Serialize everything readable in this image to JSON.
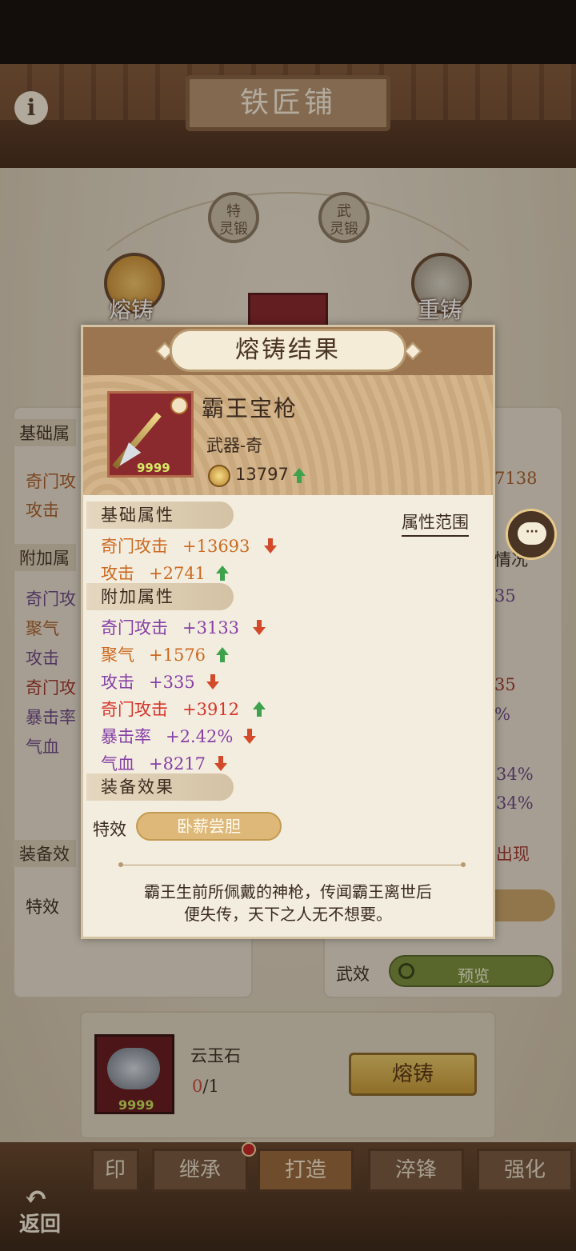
{
  "app": {
    "title": "铁匠铺",
    "info_icon": "i"
  },
  "background": {
    "top_buttons": [
      {
        "line1": "特",
        "line2": "灵锻"
      },
      {
        "line1": "武",
        "line2": "灵锻"
      }
    ],
    "left_button": "熔铸",
    "right_button": "重铸",
    "left_panel": {
      "basic_header": "基础属",
      "rows": [
        "奇门攻",
        "攻击"
      ],
      "extra_header": "附加属",
      "extra_rows": [
        "奇门攻",
        "聚气",
        "攻击",
        "奇门攻",
        "暴击率",
        "气血"
      ],
      "effects_header": "装备效",
      "special_label": "特效"
    },
    "right_panel": {
      "values": [
        "7138",
        "情况",
        "35",
        "35",
        "%",
        "34%",
        "34%",
        "出现"
      ],
      "wuxiao_label": "武效",
      "preview_label": "预览"
    },
    "material": {
      "name": "云玉石",
      "count_have": "0",
      "count_need": "/1",
      "stack": "9999",
      "forge_button": "熔铸"
    },
    "tabs": [
      "印",
      "继承",
      "打造",
      "淬锋",
      "强化"
    ],
    "active_tab": "打造",
    "back_label": "返回"
  },
  "modal": {
    "title": "熔铸结果",
    "item": {
      "name": "霸王宝枪",
      "type": "武器-奇",
      "stack": "9999",
      "power": "13797",
      "power_trend": "up"
    },
    "range_link": "属性范围",
    "basic_header": "基础属性",
    "basic_attrs": [
      {
        "name": "奇门攻击",
        "value": "+13693",
        "color": "orange",
        "trend": "down"
      },
      {
        "name": "攻击",
        "value": "+2741",
        "color": "orange",
        "trend": "up"
      }
    ],
    "extra_header": "附加属性",
    "extra_attrs": [
      {
        "name": "奇门攻击",
        "value": "+3133",
        "color": "purple",
        "trend": "down"
      },
      {
        "name": "聚气",
        "value": "+1576",
        "color": "orange",
        "trend": "up"
      },
      {
        "name": "攻击",
        "value": "+335",
        "color": "purple",
        "trend": "down"
      },
      {
        "name": "奇门攻击",
        "value": "+3912",
        "color": "red",
        "trend": "up"
      },
      {
        "name": "暴击率",
        "value": "+2.42%",
        "color": "purple",
        "trend": "down"
      },
      {
        "name": "气血",
        "value": "+8217",
        "color": "purple",
        "trend": "down"
      }
    ],
    "effects_header": "装备效果",
    "effect_label": "特效",
    "effect_name": "卧薪尝胆",
    "description_line1": "霸王生前所佩戴的神枪，传闻霸王离世后",
    "description_line2": "便失传，天下之人无不想要。"
  },
  "chat_icon": "···",
  "colors": {
    "orange": "#cc6a22",
    "red": "#d8332a",
    "purple": "#8640a6",
    "trend_up": "#3ea14b",
    "trend_down": "#d24a2a"
  }
}
